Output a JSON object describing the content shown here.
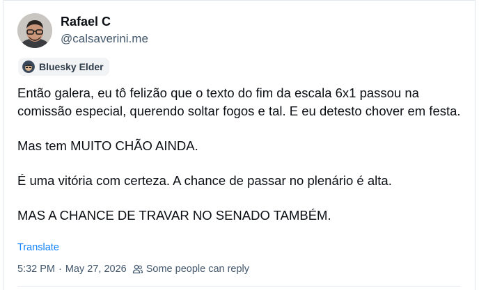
{
  "author": {
    "display_name": "Rafael C",
    "handle": "@calsaverini.me",
    "avatar_icon": "user-avatar-photo"
  },
  "badge": {
    "label": "Bluesky Elder",
    "icon": "elder-badge-icon"
  },
  "post": {
    "paragraphs": [
      "Então galera, eu tô felizão que o texto do fim da escala 6x1 passou na comissão especial, querendo soltar fogos e tal. E eu detesto chover em festa.",
      "Mas tem MUITO CHÃO AINDA.",
      "É uma vitória com certeza. A chance de passar no plenário é alta.",
      "MAS A CHANCE DE TRAVAR NO SENADO TAMBÉM."
    ]
  },
  "actions": {
    "translate_label": "Translate"
  },
  "meta": {
    "time": "5:32 PM",
    "separator": "·",
    "date": "May 27, 2026",
    "reply_setting": "Some people can reply",
    "reply_icon": "people-icon"
  },
  "colors": {
    "link": "#1083fe",
    "muted": "#42576c",
    "text": "#0b0f14",
    "badge_bg": "#f1f3f5"
  }
}
